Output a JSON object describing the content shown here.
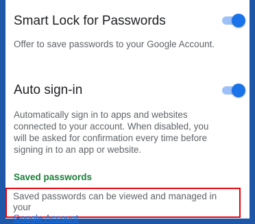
{
  "smart_lock": {
    "title": "Smart Lock for Passwords",
    "description": "Offer to save passwords to your Google Account.",
    "enabled": true
  },
  "auto_signin": {
    "title": "Auto sign-in",
    "description": "Automatically sign in to apps and websites connected to your account. When disabled, you will be asked for confirmation every time before signing in to an app or website.",
    "enabled": true
  },
  "saved_passwords": {
    "header": "Saved passwords",
    "text": "Saved passwords can be viewed and managed in your",
    "link_label": "Google Account"
  },
  "colors": {
    "accent": "#1a73e8",
    "section_header": "#188038",
    "highlight_border": "#e8000b",
    "frame": "#1e56a8"
  }
}
